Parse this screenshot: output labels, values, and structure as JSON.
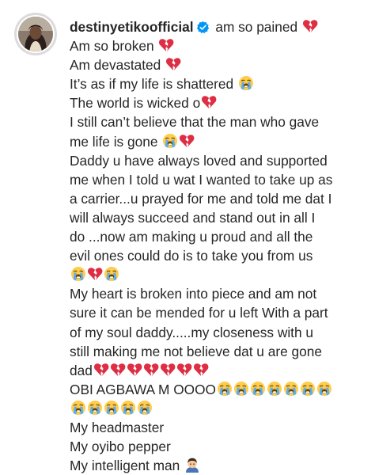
{
  "post": {
    "username": "destinyetikoofficial",
    "verified_icon": "verified-badge-icon",
    "caption_lines": [
      {
        "text": " am so pained ",
        "emojis": [
          "broken-heart"
        ]
      },
      {
        "text": "Am so broken ",
        "emojis": [
          "broken-heart"
        ]
      },
      {
        "text": "Am devastated ",
        "emojis": [
          "broken-heart"
        ]
      },
      {
        "text": "It’s as if my life is shattered ",
        "emojis": [
          "crying"
        ]
      },
      {
        "text": "The world is wicked o",
        "emojis": [
          "broken-heart"
        ]
      },
      {
        "text": "I still can’t believe that the man who gave",
        "emojis": []
      },
      {
        "text": "me life is gone ",
        "emojis": [
          "crying",
          "broken-heart"
        ]
      },
      {
        "text": "Daddy u have always loved and supported",
        "emojis": []
      },
      {
        "text": "me when I told u wat I wanted to take up as",
        "emojis": []
      },
      {
        "text": "a carrier...u prayed for me and told me dat I",
        "emojis": []
      },
      {
        "text": "will always succeed and stand out in all I",
        "emojis": []
      },
      {
        "text": "do ...now am making u proud and all the",
        "emojis": []
      },
      {
        "text": "evil ones could do is to take you from us",
        "emojis": []
      },
      {
        "text": "",
        "emojis": [
          "crying",
          "broken-heart",
          "crying"
        ]
      },
      {
        "text": "My heart is broken into piece and am not",
        "emojis": []
      },
      {
        "text": "sure it can be mended for u left With a part",
        "emojis": []
      },
      {
        "text": "of my soul daddy.....my closeness with u",
        "emojis": []
      },
      {
        "text": "still making me not believe dat u are gone",
        "emojis": []
      },
      {
        "text": "dad",
        "emojis": [
          "broken-heart",
          "broken-heart",
          "broken-heart",
          "broken-heart",
          "broken-heart",
          "broken-heart",
          "broken-heart"
        ]
      },
      {
        "text": "OBI AGBAWA M OOOO",
        "emojis": [
          "crying",
          "crying",
          "crying",
          "crying",
          "crying",
          "crying",
          "crying"
        ]
      },
      {
        "text": "",
        "emojis": [
          "crying",
          "crying",
          "crying",
          "crying",
          "crying"
        ]
      },
      {
        "text": "My headmaster",
        "emojis": []
      },
      {
        "text": "My oyibo pepper",
        "emojis": []
      },
      {
        "text": "My intelligent man ",
        "emojis": [
          "man"
        ]
      }
    ]
  },
  "colors": {
    "text": "#262626",
    "verified_blue": "#0095f6",
    "heart_red": "#dd2e44",
    "emoji_yellow": "#ffcc4d",
    "tear_blue": "#5dadec"
  }
}
